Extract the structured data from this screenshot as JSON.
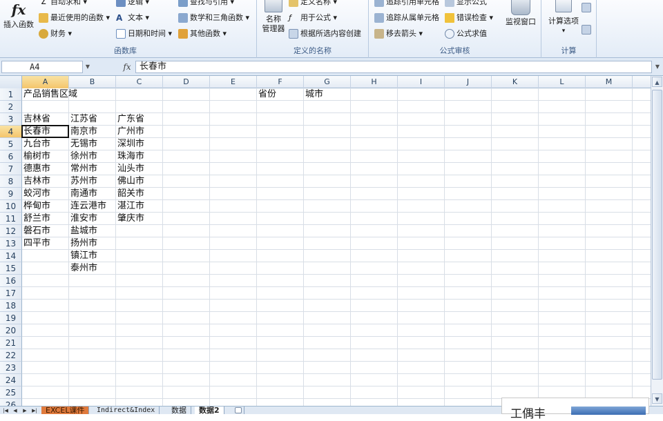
{
  "ribbon": {
    "insert_function": {
      "label": "插入函数",
      "icon": "fx-icon",
      "glyph": "fx"
    },
    "library": {
      "title": "函数库",
      "autosum": "自动求和 ▾",
      "recent": "最近使用的函数 ▾",
      "financial": "财务 ▾",
      "logical": "逻辑 ▾",
      "text": "文本 ▾",
      "datetime": "日期和时间 ▾",
      "lookup": "查找与引用 ▾",
      "math": "数学和三角函数 ▾",
      "more": "其他函数 ▾"
    },
    "names": {
      "title": "定义的名称",
      "manager_line1": "名称",
      "manager_line2": "管理器",
      "define": "定义名称 ▾",
      "use_in_formula": "用于公式 ▾",
      "create_from_selection": "根据所选内容创建"
    },
    "audit": {
      "title": "公式审核",
      "trace_precedents": "追踪引用单元格",
      "trace_dependents": "追踪从属单元格",
      "remove_arrows": "移去箭头 ▾",
      "show_formulas": "显示公式",
      "error_check": "错误检查 ▾",
      "evaluate": "公式求值",
      "watch_window": "监视窗口"
    },
    "calc": {
      "title": "计算",
      "options": "计算选项",
      "options_arrow": "▾"
    }
  },
  "formula_bar": {
    "name_box": "A4",
    "fx_label": "fx",
    "value": "长春市"
  },
  "columns": [
    "A",
    "B",
    "C",
    "D",
    "E",
    "F",
    "G",
    "H",
    "I",
    "J",
    "K",
    "L",
    "M"
  ],
  "rows": [
    "1",
    "2",
    "3",
    "4",
    "5",
    "6",
    "7",
    "8",
    "9",
    "10",
    "11",
    "12",
    "13",
    "14",
    "15",
    "16",
    "17",
    "18",
    "19",
    "20",
    "21",
    "22",
    "23",
    "24",
    "25",
    "26"
  ],
  "active_cell": "A4",
  "cells": {
    "A1": "产品销售区域",
    "F1": "省份",
    "G1": "城市",
    "A3": "吉林省",
    "B3": "江苏省",
    "C3": "广东省",
    "A4": "长春市",
    "B4": "南京市",
    "C4": "广州市",
    "A5": "九台市",
    "B5": "无锡市",
    "C5": "深圳市",
    "A6": "榆树市",
    "B6": "徐州市",
    "C6": "珠海市",
    "A7": "德惠市",
    "B7": "常州市",
    "C7": "汕头市",
    "A8": "吉林市",
    "B8": "苏州市",
    "C8": "佛山市",
    "A9": "蛟河市",
    "B9": "南通市",
    "C9": "韶关市",
    "A10": "桦甸市",
    "B10": "连云港市",
    "C10": "湛江市",
    "A11": "舒兰市",
    "B11": "淮安市",
    "C11": "肇庆市",
    "A12": "磐石市",
    "B12": "盐城市",
    "A13": "四平市",
    "B13": "扬州市",
    "B14": "镇江市",
    "B15": "泰州市"
  },
  "sheet_tabs": [
    "EXCEL课件",
    "Indirect&Index",
    "数据",
    "数据2"
  ],
  "active_sheet": "数据2",
  "tab_nav": [
    "|◀",
    "◀",
    "▶",
    "▶|"
  ],
  "watermark": {
    "text": "工偶丰"
  },
  "colors": {
    "ribbon_bg": "#e3ecf7",
    "header_bg": "#e4ebf4",
    "selected_header": "#f4c56b",
    "gridline": "#d8dee6",
    "active_tab": "#ffffff"
  }
}
